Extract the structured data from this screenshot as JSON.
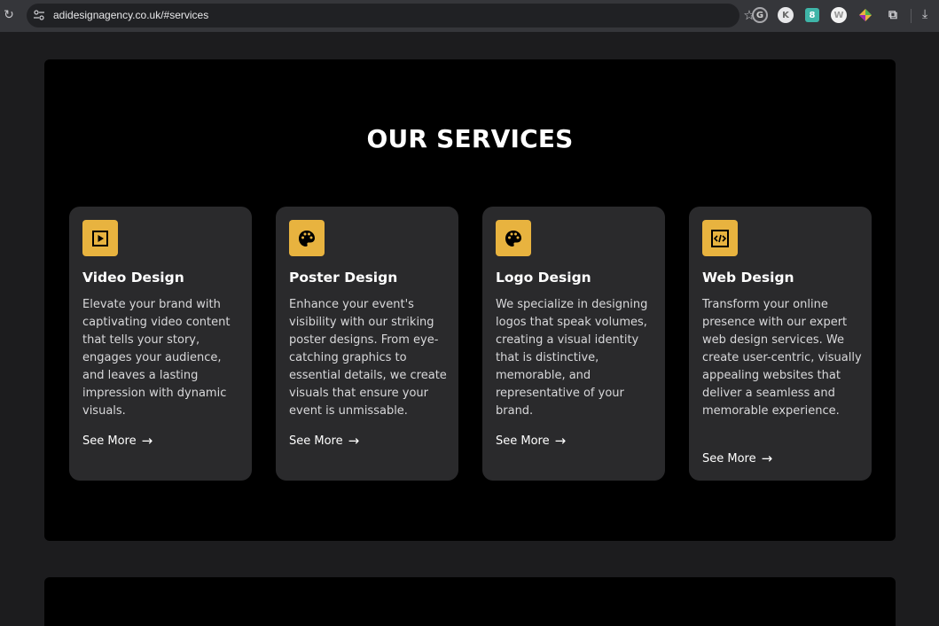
{
  "browser": {
    "url": "adidesignagency.co.uk/#services"
  },
  "services": {
    "title": "OUR SERVICES",
    "cards": [
      {
        "icon": "play-icon",
        "title": "Video Design",
        "description": "Elevate your brand with captivating video content that tells your story, engages your audience, and leaves a lasting impression with dynamic visuals.",
        "link": "See More"
      },
      {
        "icon": "palette-icon",
        "title": "Poster Design",
        "description": "Enhance your event's visibility with our striking poster designs. From eye-catching graphics to essential details, we create visuals that ensure your event is unmissable.",
        "link": "See More"
      },
      {
        "icon": "palette-icon",
        "title": "Logo Design",
        "description": "We specialize in designing logos that speak volumes, creating a visual identity that is distinctive, memorable, and representative of your brand.",
        "link": "See More"
      },
      {
        "icon": "code-icon",
        "title": "Web Design",
        "description": "Transform your online presence with our expert web design services. We create user-centric, visually appealing websites that deliver a seamless and memorable experience.",
        "link": "See More"
      }
    ]
  },
  "colors": {
    "page_bg": "#1c1c1e",
    "section_bg": "#000000",
    "card_bg": "#2a2a2c",
    "accent": "#e8b33f"
  }
}
